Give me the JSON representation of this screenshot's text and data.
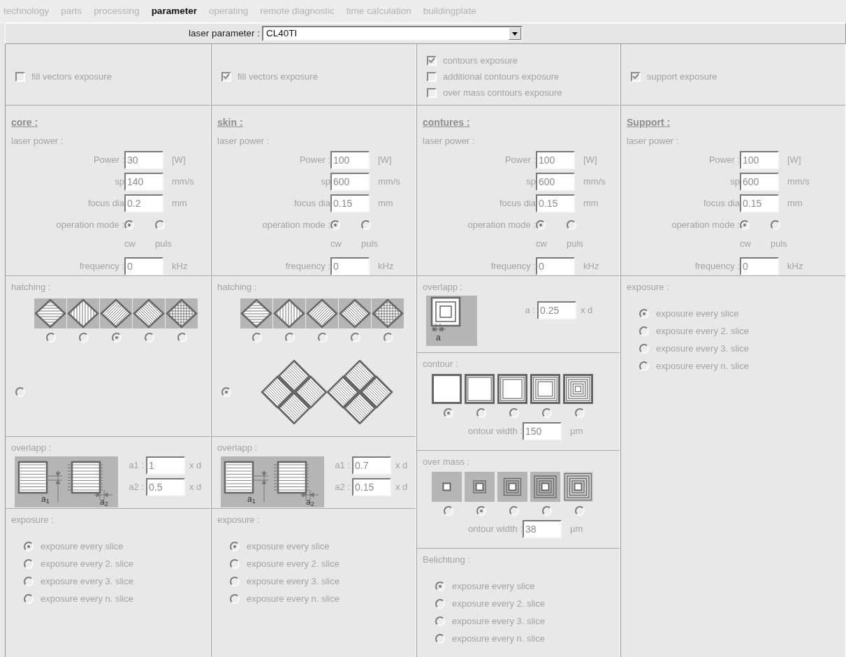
{
  "tabs": [
    {
      "label": "technology",
      "selected": false
    },
    {
      "label": "parts",
      "selected": false
    },
    {
      "label": "processing",
      "selected": false
    },
    {
      "label": "parameter",
      "selected": true
    },
    {
      "label": "operating",
      "selected": false
    },
    {
      "label": "remote diagnostic",
      "selected": false
    },
    {
      "label": "time calculation",
      "selected": false
    },
    {
      "label": "buildingplate",
      "selected": false
    }
  ],
  "laser_parameter": {
    "label": "laser parameter :",
    "value": "CL40TI"
  },
  "columns": [
    {
      "sections": [
        {
          "kind": "checks",
          "items": [
            {
              "label": "fill vectors exposure",
              "checked": false
            }
          ]
        },
        {
          "kind": "laser",
          "title": "core :",
          "subtitle": "laser power :",
          "fields": [
            {
              "label": "Power :",
              "value": "30",
              "unit": "[W]"
            },
            {
              "label": "sp",
              "value": "140",
              "unit": "mm/s"
            },
            {
              "label": "focus dia",
              "value": "0.2",
              "unit": "mm"
            }
          ],
          "mode": {
            "label": "operation mode :",
            "options": [
              {
                "label": "cw",
                "selected": true
              },
              {
                "label": "puls",
                "selected": false
              }
            ]
          },
          "frequency": {
            "label": "frequency :",
            "value": "0",
            "unit": "kHz"
          }
        },
        {
          "kind": "hatching",
          "title": "hatching :",
          "patterns": [
            {
              "selected": false
            },
            {
              "selected": false
            },
            {
              "selected": true
            },
            {
              "selected": false
            },
            {
              "selected": false
            }
          ],
          "alternative": {
            "selected": false,
            "pattern_drawn": false
          }
        },
        {
          "kind": "overlap",
          "title": "overlapp :",
          "diagram_labels": [
            "a$_{1}$",
            "a$_{2}$"
          ],
          "fields": [
            {
              "label": "a1 :",
              "value": "1",
              "unit": "x d"
            },
            {
              "label": "a2 :",
              "value": "0.5",
              "unit": "x d"
            }
          ]
        },
        {
          "kind": "exposure",
          "title": "exposure :",
          "options": [
            {
              "label": "exposure every slice",
              "selected": true
            },
            {
              "label": "exposure every 2. slice",
              "selected": false
            },
            {
              "label": "exposure every 3. slice",
              "selected": false
            },
            {
              "label": "exposure every n. slice",
              "selected": false
            }
          ]
        }
      ]
    },
    {
      "sections": [
        {
          "kind": "checks",
          "items": [
            {
              "label": "fill vectors exposure",
              "checked": true
            }
          ]
        },
        {
          "kind": "laser",
          "title": "skin :",
          "subtitle": "laser power :",
          "fields": [
            {
              "label": "Power :",
              "value": "100",
              "unit": "[W]"
            },
            {
              "label": "sp",
              "value": "600",
              "unit": "mm/s"
            },
            {
              "label": "focus dia",
              "value": "0.15",
              "unit": "mm"
            }
          ],
          "mode": {
            "label": "operation mode :",
            "options": [
              {
                "label": "cw",
                "selected": true
              },
              {
                "label": "puls",
                "selected": false
              }
            ]
          },
          "frequency": {
            "label": "frequency :",
            "value": "0",
            "unit": "kHz"
          }
        },
        {
          "kind": "hatching",
          "title": "hatching :",
          "patterns": [
            {
              "selected": false
            },
            {
              "selected": false
            },
            {
              "selected": false
            },
            {
              "selected": false
            },
            {
              "selected": false
            }
          ],
          "alternative": {
            "selected": true,
            "pattern_drawn": true
          }
        },
        {
          "kind": "overlap",
          "title": "overlapp :",
          "diagram_labels": [
            "a$_{1}$",
            "a$_{2}$"
          ],
          "fields": [
            {
              "label": "a1 :",
              "value": "0.7",
              "unit": "x d"
            },
            {
              "label": "a2 :",
              "value": "0.15",
              "unit": "x d"
            }
          ]
        },
        {
          "kind": "exposure",
          "title": "exposure :",
          "options": [
            {
              "label": "exposure every slice",
              "selected": true
            },
            {
              "label": "exposure every 2. slice",
              "selected": false
            },
            {
              "label": "exposure every 3. slice",
              "selected": false
            },
            {
              "label": "exposure every n. slice",
              "selected": false
            }
          ]
        }
      ]
    },
    {
      "sections": [
        {
          "kind": "checks",
          "items": [
            {
              "label": "contours exposure",
              "checked": true
            },
            {
              "label": "additional contours exposure",
              "checked": false
            },
            {
              "label": "over mass contours exposure",
              "checked": false
            }
          ]
        },
        {
          "kind": "laser",
          "title": "contures :",
          "subtitle": "laser power :",
          "fields": [
            {
              "label": "Power :",
              "value": "100",
              "unit": "[W]"
            },
            {
              "label": "sp",
              "value": "600",
              "unit": "mm/s"
            },
            {
              "label": "focus dia",
              "value": "0.15",
              "unit": "mm"
            }
          ],
          "mode": {
            "label": "operation mode :",
            "options": [
              {
                "label": "cw",
                "selected": true
              },
              {
                "label": "puls",
                "selected": false
              }
            ]
          },
          "frequency": {
            "label": "frequency :",
            "value": "0",
            "unit": "kHz"
          }
        },
        {
          "kind": "contour-overlap",
          "title": "overlapp :",
          "diagram_labels": [
            "a"
          ],
          "fields": [
            {
              "label": "a :",
              "value": "0.25",
              "unit": "x d"
            }
          ]
        },
        {
          "kind": "contour",
          "title": "contour :",
          "patterns": [
            {
              "selected": true
            },
            {
              "selected": false
            },
            {
              "selected": false
            },
            {
              "selected": false
            },
            {
              "selected": false
            }
          ],
          "width": {
            "label": "ontour width :",
            "value": "150",
            "unit": "µm"
          }
        },
        {
          "kind": "overmass",
          "title": "over mass :",
          "patterns": [
            {
              "selected": false
            },
            {
              "selected": true
            },
            {
              "selected": false
            },
            {
              "selected": false
            },
            {
              "selected": false
            }
          ],
          "width": {
            "label": "ontour width :",
            "value": "38",
            "unit": "µm"
          }
        },
        {
          "kind": "exposure",
          "title": "Belichtung :",
          "options": [
            {
              "label": "exposure every slice",
              "selected": true
            },
            {
              "label": "exposure every 2. slice",
              "selected": false
            },
            {
              "label": "exposure every 3. slice",
              "selected": false
            },
            {
              "label": "exposure every n. slice",
              "selected": false
            }
          ]
        }
      ]
    },
    {
      "sections": [
        {
          "kind": "checks",
          "items": [
            {
              "label": "support exposure",
              "checked": true
            }
          ]
        },
        {
          "kind": "laser",
          "title": "Support :",
          "subtitle": "laser power :",
          "fields": [
            {
              "label": "Power :",
              "value": "100",
              "unit": "[W]"
            },
            {
              "label": "sp",
              "value": "600",
              "unit": "mm/s"
            },
            {
              "label": "focus dia",
              "value": "0.15",
              "unit": "mm"
            }
          ],
          "mode": {
            "label": "operation mode :",
            "options": [
              {
                "label": "cw",
                "selected": true
              },
              {
                "label": "puls",
                "selected": false
              }
            ]
          },
          "frequency": {
            "label": "frequency :",
            "value": "0",
            "unit": "kHz"
          }
        },
        {
          "kind": "exposure",
          "title": "exposure :",
          "options": [
            {
              "label": "exposure every slice",
              "selected": true
            },
            {
              "label": "exposure every 2. slice",
              "selected": false
            },
            {
              "label": "exposure every 3. slice",
              "selected": false
            },
            {
              "label": "exposure every n. slice",
              "selected": false
            }
          ]
        }
      ]
    }
  ]
}
